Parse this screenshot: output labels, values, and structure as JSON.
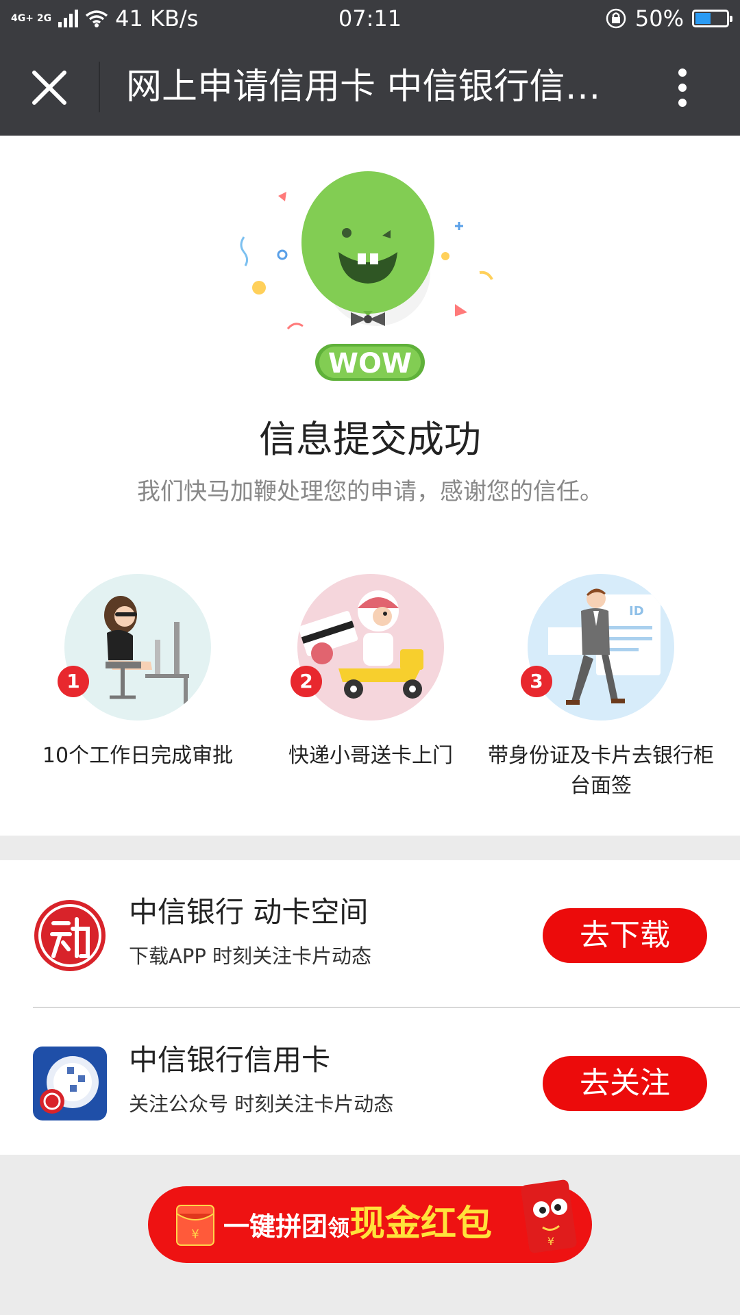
{
  "status_bar": {
    "network": "4G+ 2G",
    "speed": "41 KB/s",
    "time": "07:11",
    "battery": "50%",
    "battery_level": 0.5,
    "icons": [
      "signal-icon",
      "wifi-icon",
      "rotation-lock-icon",
      "battery-icon"
    ]
  },
  "title_bar": {
    "title": "网上申请信用卡 中信银行信…",
    "close_icon": "close-icon",
    "more_icon": "more-vertical-icon",
    "background": "#3b3c40"
  },
  "hero": {
    "badge_text": "WOW",
    "title": "信息提交成功",
    "subtitle": "我们快马加鞭处理您的申请，感谢您的信任。"
  },
  "steps": [
    {
      "number": "1",
      "label": "10个工作日完成审批",
      "circle_color": "#e3f2f2"
    },
    {
      "number": "2",
      "label": "快递小哥送卡上门",
      "circle_color": "#f5d6dc"
    },
    {
      "number": "3",
      "label": "带身份证及卡片去银行柜台面签",
      "circle_color": "#d7ecfa"
    }
  ],
  "apps": [
    {
      "title": "中信银行 动卡空间",
      "subtitle": "下载APP 时刻关注卡片动态",
      "button": "去下载",
      "icon": "dongka-logo-icon"
    },
    {
      "title": "中信银行信用卡",
      "subtitle": "关注公众号 时刻关注卡片动态",
      "button": "去关注",
      "icon": "citic-credit-card-logo-icon"
    }
  ],
  "banner": {
    "text_part1": "一键拼团",
    "text_part2": "领",
    "text_highlight": "现金红包",
    "icon": "red-envelope-icon"
  },
  "colors": {
    "accent_red": "#ec0b0b",
    "balloon_green": "#82cd53",
    "highlight_yellow": "#ffe23b"
  }
}
